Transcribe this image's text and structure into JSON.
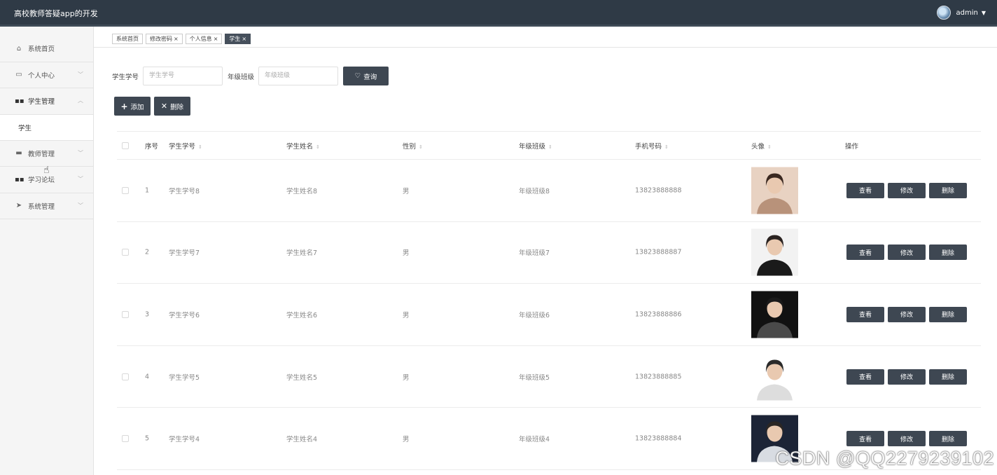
{
  "app": {
    "title": "高校教师答疑app的开发",
    "username": "admin"
  },
  "sidebar": {
    "items": [
      {
        "label": "系统首页",
        "icon": "home-icon"
      },
      {
        "label": "个人中心",
        "icon": "card-icon"
      },
      {
        "label": "学生管理",
        "icon": "grid-icon",
        "expanded": true
      },
      {
        "label": "学生",
        "sub": true
      },
      {
        "label": "教师管理",
        "icon": "monitor-icon"
      },
      {
        "label": "学习论坛",
        "icon": "grid-icon"
      },
      {
        "label": "系统管理",
        "icon": "send-icon"
      }
    ]
  },
  "tabs": [
    {
      "label": "系统首页"
    },
    {
      "label": "修改密码",
      "close": "×"
    },
    {
      "label": "个人信息",
      "close": "×"
    },
    {
      "label": "学生",
      "close": "×",
      "active": true
    }
  ],
  "search": {
    "student_no_label": "学生学号",
    "student_no_placeholder": "学生学号",
    "class_label": "年级班级",
    "class_placeholder": "年级班级",
    "query_button": "查询"
  },
  "toolbar": {
    "add_label": "添加",
    "delete_label": "删除"
  },
  "table": {
    "headers": [
      "序号",
      "学生学号",
      "学生姓名",
      "性别",
      "年级班级",
      "手机号码",
      "头像",
      "操作"
    ],
    "rows": [
      {
        "index": "1",
        "student_no": "学生学号8",
        "name": "学生姓名8",
        "gender": "男",
        "class": "年级班级8",
        "phone": "13823888888"
      },
      {
        "index": "2",
        "student_no": "学生学号7",
        "name": "学生姓名7",
        "gender": "男",
        "class": "年级班级7",
        "phone": "13823888887"
      },
      {
        "index": "3",
        "student_no": "学生学号6",
        "name": "学生姓名6",
        "gender": "男",
        "class": "年级班级6",
        "phone": "13823888886"
      },
      {
        "index": "4",
        "student_no": "学生学号5",
        "name": "学生姓名5",
        "gender": "男",
        "class": "年级班级5",
        "phone": "13823888885"
      },
      {
        "index": "5",
        "student_no": "学生学号4",
        "name": "学生姓名4",
        "gender": "男",
        "class": "年级班级4",
        "phone": "13823888884"
      }
    ],
    "actions": {
      "view": "查看",
      "edit": "修改",
      "delete": "删除"
    }
  },
  "watermark": "CSDN @QQ2279239102",
  "colors": {
    "header_bg": "#2f3a46",
    "button_bg": "#3e4752",
    "sidebar_bg": "#f5f5f5"
  }
}
